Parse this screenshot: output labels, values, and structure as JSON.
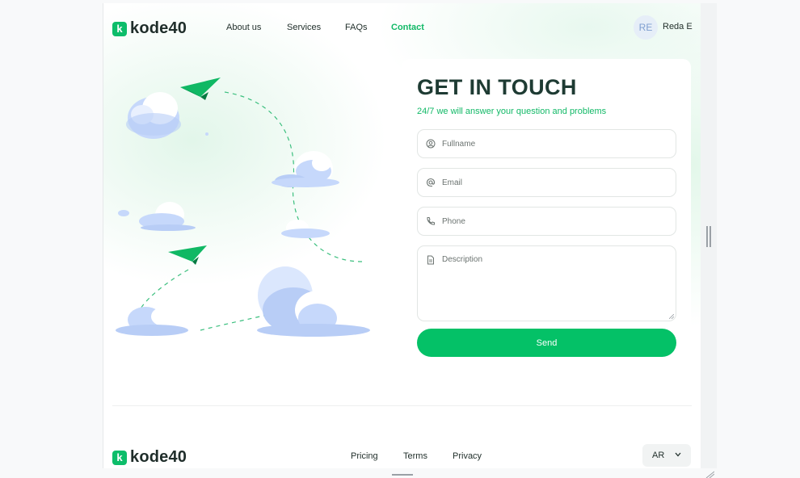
{
  "brand": {
    "name": "kode40",
    "mark": "k",
    "color": "#0dbd6a"
  },
  "nav": {
    "items": [
      {
        "label": "About us"
      },
      {
        "label": "Services"
      },
      {
        "label": "FAQs"
      },
      {
        "label": "Contact",
        "active": true
      }
    ]
  },
  "user": {
    "initials": "RE",
    "name": "Reda E"
  },
  "form": {
    "title": "GET IN TOUCH",
    "subtitle": "24/7 we will answer your question and problems",
    "fields": {
      "fullname": {
        "placeholder": "Fullname",
        "icon": "user-circle-icon"
      },
      "email": {
        "placeholder": "Email",
        "icon": "at-icon"
      },
      "phone": {
        "placeholder": "Phone",
        "icon": "phone-icon"
      },
      "description": {
        "placeholder": "Description",
        "icon": "document-icon"
      }
    },
    "submit_label": "Send"
  },
  "footer": {
    "links": [
      "Pricing",
      "Terms",
      "Privacy"
    ],
    "language": {
      "value": "AR"
    }
  },
  "colors": {
    "accent": "#04c167",
    "heading": "#1e3b33",
    "cloud": "#b8cdf6"
  }
}
